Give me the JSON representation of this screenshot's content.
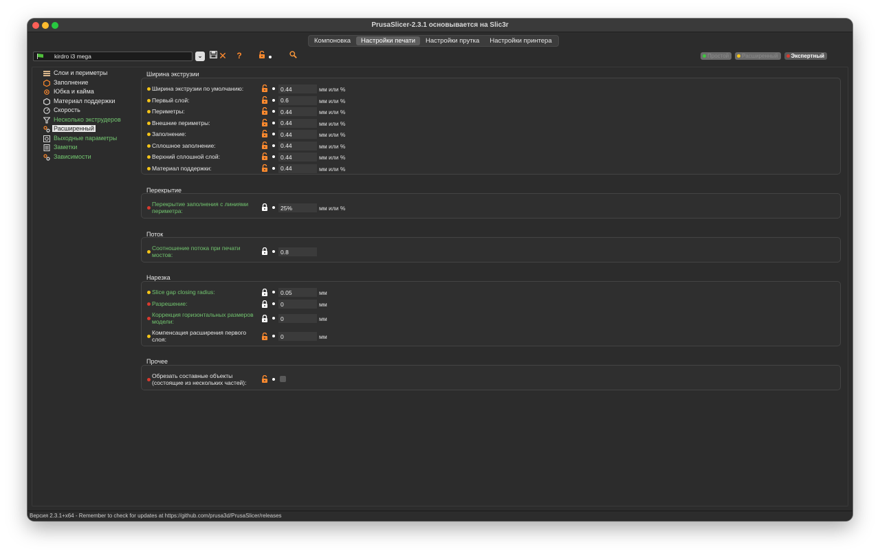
{
  "window": {
    "title": "PrusaSlicer-2.3.1 основывается на Slic3r"
  },
  "tabs": [
    {
      "label": "Компоновка",
      "active": false
    },
    {
      "label": "Настройки печати",
      "active": true
    },
    {
      "label": "Настройки прутка",
      "active": false
    },
    {
      "label": "Настройки принтера",
      "active": false
    }
  ],
  "preset": {
    "name": "kirdro i3 mega"
  },
  "toolbar": {
    "dropdown_icon": "chevron-down-icon",
    "save_icon": "save-icon",
    "delete_icon": "delete-icon",
    "help_icon": "question-icon",
    "lock_icon": "unlocked-icon",
    "search_icon": "search-icon"
  },
  "modes": [
    {
      "label": "Простой",
      "color": "#3fc53f"
    },
    {
      "label": "Расширенный",
      "color": "#f5c518"
    },
    {
      "label": "Экспертный",
      "color": "#d83a2e"
    }
  ],
  "sidebar": {
    "items": [
      {
        "label": "Слои и периметры",
        "green": false,
        "icon": "layers-icon"
      },
      {
        "label": "Заполнение",
        "green": false,
        "icon": "infill-icon"
      },
      {
        "label": "Юбка и кайма",
        "green": false,
        "icon": "skirt-icon"
      },
      {
        "label": "Материал поддержки",
        "green": false,
        "icon": "support-icon"
      },
      {
        "label": "Скорость",
        "green": false,
        "icon": "speed-icon"
      },
      {
        "label": "Несколько экструдеров",
        "green": true,
        "icon": "funnel-icon"
      },
      {
        "label": "Расширенный",
        "green": false,
        "icon": "wrench-icon",
        "selected": true
      },
      {
        "label": "Выходные параметры",
        "green": true,
        "icon": "output-icon"
      },
      {
        "label": "Заметки",
        "green": true,
        "icon": "notes-icon"
      },
      {
        "label": "Зависимости",
        "green": true,
        "icon": "dependencies-icon"
      }
    ]
  },
  "sections": {
    "extrusion_width": {
      "title": "Ширина экструзии",
      "rows": [
        {
          "label": "Ширина экструзии по умолчанию:",
          "value": "0.44",
          "unit": "мм или %",
          "dot": "y",
          "lock": "open",
          "green": false
        },
        {
          "label": "Первый слой:",
          "value": "0.6",
          "unit": "мм или %",
          "dot": "y",
          "lock": "open",
          "green": false
        },
        {
          "label": "Периметры:",
          "value": "0.44",
          "unit": "мм или %",
          "dot": "y",
          "lock": "open",
          "green": false
        },
        {
          "label": "Внешние периметры:",
          "value": "0.44",
          "unit": "мм или %",
          "dot": "y",
          "lock": "open",
          "green": false
        },
        {
          "label": "Заполнение:",
          "value": "0.44",
          "unit": "мм или %",
          "dot": "y",
          "lock": "open",
          "green": false
        },
        {
          "label": "Сплошное заполнение:",
          "value": "0.44",
          "unit": "мм или %",
          "dot": "y",
          "lock": "open",
          "green": false
        },
        {
          "label": "Верхний сплошной слой:",
          "value": "0.44",
          "unit": "мм или %",
          "dot": "y",
          "lock": "open",
          "green": false
        },
        {
          "label": "Материал поддержки:",
          "value": "0.44",
          "unit": "мм или %",
          "dot": "y",
          "lock": "open",
          "green": false
        }
      ]
    },
    "overlap": {
      "title": "Перекрытие",
      "rows": [
        {
          "label": "Перекрытие заполнения с линиями периметра:",
          "value": "25%",
          "unit": "мм или %",
          "dot": "r",
          "lock": "closed",
          "green": true
        }
      ]
    },
    "flow": {
      "title": "Поток",
      "rows": [
        {
          "label": "Соотношение потока при печати мостов:",
          "value": "0.8",
          "unit": "",
          "dot": "y",
          "lock": "closed",
          "green": true
        }
      ]
    },
    "slicing": {
      "title": "Нарезка",
      "rows": [
        {
          "label": "Slice gap closing radius:",
          "value": "0.05",
          "unit": "мм",
          "dot": "y",
          "lock": "closed",
          "green": true
        },
        {
          "label": "Разрешение:",
          "value": "0",
          "unit": "мм",
          "dot": "r",
          "lock": "closed",
          "green": true
        },
        {
          "label": "Коррекция горизонтальных размеров модели:",
          "value": "0",
          "unit": "мм",
          "dot": "r",
          "lock": "closed",
          "green": true
        },
        {
          "label": "Компенсация расширения первого слоя:",
          "value": "0",
          "unit": "мм",
          "dot": "y",
          "lock": "open",
          "green": false
        }
      ]
    },
    "other": {
      "title": "Прочее",
      "rows": [
        {
          "label": "Обрезать составные объекты (состоящие из нескольких частей):",
          "checked": false,
          "dot": "r",
          "lock": "open",
          "green": false
        }
      ]
    }
  },
  "statusbar": {
    "text": "Версия 2.3.1+x64 - Remember to check for updates at https://github.com/prusa3d/PrusaSlicer/releases"
  }
}
